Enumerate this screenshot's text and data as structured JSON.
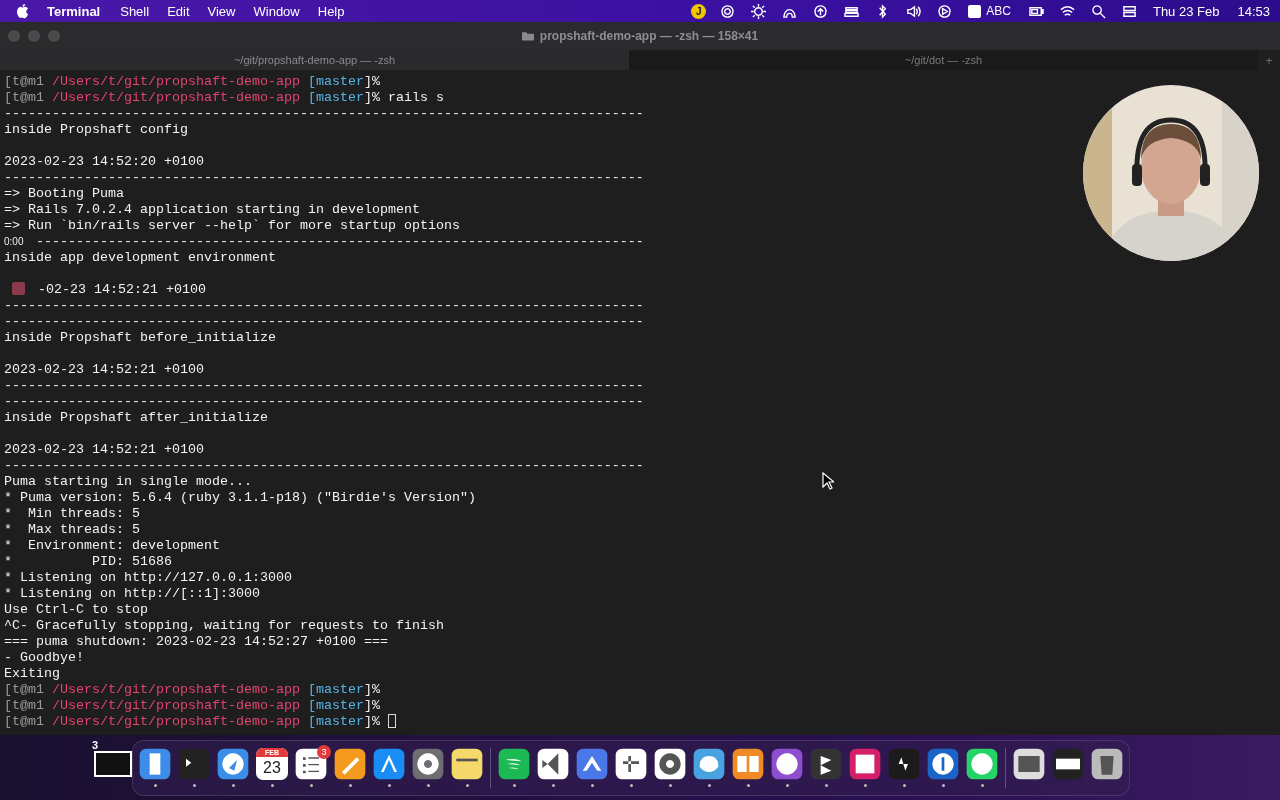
{
  "menubar": {
    "app": "Terminal",
    "menus": [
      "Shell",
      "Edit",
      "View",
      "Window",
      "Help"
    ],
    "avatar": "J",
    "input_source": "ABC",
    "date": "Thu 23 Feb",
    "time": "14:53"
  },
  "window": {
    "title": "propshaft-demo-app — -zsh — 158×41"
  },
  "tabs": [
    {
      "label": "~/git/propshaft-demo-app — -zsh",
      "selected": true
    },
    {
      "label": "~/git/dot — -zsh",
      "selected": false
    }
  ],
  "new_tab": "+",
  "terminal": {
    "lines": [
      {
        "kind": "prompt",
        "user": "[t@m1",
        "path": "/Users/t/git/propshaft-demo-app",
        "branch": "[master",
        "sign": "]%",
        "cursor": false
      },
      {
        "kind": "prompt",
        "user": "[t@m1",
        "path": "/Users/t/git/propshaft-demo-app",
        "branch": "[master",
        "sign": "]%",
        "command": "rails s",
        "cursor": false
      },
      {
        "kind": "text",
        "text": "--------------------------------------------------------------------------------"
      },
      {
        "kind": "text",
        "text": "inside Propshaft config"
      },
      {
        "kind": "blank"
      },
      {
        "kind": "text",
        "text": "2023-02-23 14:52:20 +0100"
      },
      {
        "kind": "text",
        "text": "--------------------------------------------------------------------------------"
      },
      {
        "kind": "text",
        "text": "=> Booting Puma"
      },
      {
        "kind": "text",
        "text": "=> Rails 7.0.2.4 application starting in development"
      },
      {
        "kind": "text",
        "text": "=> Run `bin/rails server --help` for more startup options"
      },
      {
        "kind": "overlay",
        "time": "0:00",
        "text": "----------------------------------------------------------------------------"
      },
      {
        "kind": "text",
        "text": "inside app development environment"
      },
      {
        "kind": "blank"
      },
      {
        "kind": "covered",
        "text": "-02-23 14:52:21 +0100"
      },
      {
        "kind": "text",
        "text": "--------------------------------------------------------------------------------"
      },
      {
        "kind": "text",
        "text": "--------------------------------------------------------------------------------"
      },
      {
        "kind": "text",
        "text": "inside Propshaft before_initialize"
      },
      {
        "kind": "blank"
      },
      {
        "kind": "text",
        "text": "2023-02-23 14:52:21 +0100"
      },
      {
        "kind": "text",
        "text": "--------------------------------------------------------------------------------"
      },
      {
        "kind": "text",
        "text": "--------------------------------------------------------------------------------"
      },
      {
        "kind": "text",
        "text": "inside Propshaft after_initialize"
      },
      {
        "kind": "blank"
      },
      {
        "kind": "text",
        "text": "2023-02-23 14:52:21 +0100"
      },
      {
        "kind": "text",
        "text": "--------------------------------------------------------------------------------"
      },
      {
        "kind": "text",
        "text": "Puma starting in single mode..."
      },
      {
        "kind": "text",
        "text": "* Puma version: 5.6.4 (ruby 3.1.1-p18) (\"Birdie's Version\")"
      },
      {
        "kind": "text",
        "text": "*  Min threads: 5"
      },
      {
        "kind": "text",
        "text": "*  Max threads: 5"
      },
      {
        "kind": "text",
        "text": "*  Environment: development"
      },
      {
        "kind": "text",
        "text": "*          PID: 51686"
      },
      {
        "kind": "text",
        "text": "* Listening on http://127.0.0.1:3000"
      },
      {
        "kind": "text",
        "text": "* Listening on http://[::1]:3000"
      },
      {
        "kind": "text",
        "text": "Use Ctrl-C to stop"
      },
      {
        "kind": "text",
        "text": "^C- Gracefully stopping, waiting for requests to finish"
      },
      {
        "kind": "text",
        "text": "=== puma shutdown: 2023-02-23 14:52:27 +0100 ==="
      },
      {
        "kind": "text",
        "text": "- Goodbye!"
      },
      {
        "kind": "text",
        "text": "Exiting"
      },
      {
        "kind": "prompt",
        "user": "[t@m1",
        "path": "/Users/t/git/propshaft-demo-app",
        "branch": "[master",
        "sign": "]%",
        "cursor": false
      },
      {
        "kind": "prompt",
        "user": "[t@m1",
        "path": "/Users/t/git/propshaft-demo-app",
        "branch": "[master",
        "sign": "]%",
        "cursor": false
      },
      {
        "kind": "prompt",
        "user": "[t@m1",
        "path": "/Users/t/git/propshaft-demo-app",
        "branch": "[master",
        "sign": "]%",
        "cursor": true
      }
    ]
  },
  "dock": {
    "space": {
      "label": "3"
    },
    "items": [
      {
        "kind": "app",
        "running": true
      },
      {
        "kind": "app",
        "running": true
      },
      {
        "kind": "app",
        "running": true
      },
      {
        "kind": "calendar",
        "month": "FEB",
        "day": "23",
        "running": true
      },
      {
        "kind": "app",
        "badge": "3",
        "running": true
      },
      {
        "kind": "app",
        "running": true
      },
      {
        "kind": "app",
        "running": true
      },
      {
        "kind": "app",
        "running": true
      },
      {
        "kind": "app",
        "running": true
      },
      {
        "kind": "separator"
      },
      {
        "kind": "app",
        "running": true
      },
      {
        "kind": "app",
        "running": true
      },
      {
        "kind": "app",
        "running": true
      },
      {
        "kind": "app",
        "running": true
      },
      {
        "kind": "app",
        "running": true
      },
      {
        "kind": "app",
        "running": true
      },
      {
        "kind": "app",
        "running": true
      },
      {
        "kind": "app",
        "running": true
      },
      {
        "kind": "app",
        "running": true
      },
      {
        "kind": "app",
        "running": true
      },
      {
        "kind": "app",
        "running": true
      },
      {
        "kind": "app",
        "running": true
      },
      {
        "kind": "app",
        "running": true
      },
      {
        "kind": "separator"
      },
      {
        "kind": "app",
        "running": false
      },
      {
        "kind": "app",
        "running": false
      },
      {
        "kind": "app",
        "running": false
      }
    ]
  }
}
